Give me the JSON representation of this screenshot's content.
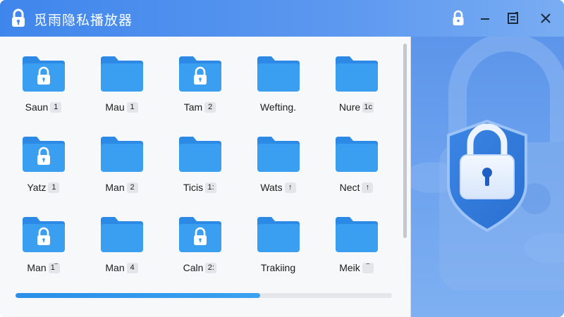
{
  "window": {
    "title": "觅雨隐私播放器",
    "buttons": [
      "lock",
      "minimize",
      "restore",
      "close"
    ]
  },
  "colors": {
    "accent": "#2a8fe8",
    "titlebar": "#4a8ded",
    "folder": "#3a9ff0",
    "folder_dark": "#2c8ae6",
    "art_background": "#6ea3ef"
  },
  "folders": [
    {
      "name": "Saun",
      "badge": "1",
      "locked": true
    },
    {
      "name": "Mau",
      "badge": "1",
      "locked": false
    },
    {
      "name": "Tam",
      "badge": "2",
      "locked": true
    },
    {
      "name": "Wefting.",
      "badge": "",
      "locked": false
    },
    {
      "name": "Nure",
      "badge": "1c",
      "locked": false
    },
    {
      "name": "Yatz",
      "badge": "1",
      "locked": true
    },
    {
      "name": "Man",
      "badge": "2",
      "locked": false
    },
    {
      "name": "Ticis",
      "badge": "1:",
      "locked": false
    },
    {
      "name": "Wats",
      "badge": "↑",
      "locked": false
    },
    {
      "name": "Nect",
      "badge": "↑",
      "locked": false
    },
    {
      "name": "Man",
      "badge": "1‾",
      "locked": true
    },
    {
      "name": "Man",
      "badge": "4",
      "locked": false
    },
    {
      "name": "Caln",
      "badge": "2:",
      "locked": true
    },
    {
      "name": "Trakiing",
      "badge": "",
      "locked": false
    },
    {
      "name": "Meik",
      "badge": "‾",
      "locked": false
    }
  ],
  "progress": {
    "fraction": 0.65
  }
}
